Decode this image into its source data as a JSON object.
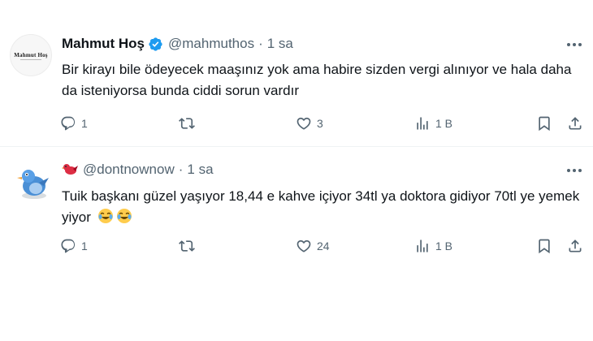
{
  "tweets": [
    {
      "avatar_text": "Mahmut Hoş",
      "name": "Mahmut Hoş",
      "verified": true,
      "handle": "@mahmuthos",
      "separator": "·",
      "time": "1 sa",
      "text": "Bir kirayı bile ödeyecek maaşınız yok ama habire sizden vergi alınıyor ve hala daha da isteniyorsa bunda ciddi sorun vardır",
      "emojis": [],
      "replies": "1",
      "retweets": "",
      "likes": "3",
      "views": "1 B"
    },
    {
      "avatar_icon": "bird-avatar",
      "name_emoji": "red-bird-emoji",
      "handle": "@dontnownow",
      "separator": "·",
      "time": "1 sa",
      "text": "Tuik başkanı güzel yaşıyor 18,44 e kahve içiyor 34tl ya doktora gidiyor 70tl ye yemek yiyor",
      "emojis": [
        "tears-of-joy-emoji",
        "tears-of-joy-emoji"
      ],
      "replies": "1",
      "retweets": "",
      "likes": "24",
      "views": "1 B"
    }
  ],
  "colors": {
    "text_primary": "#0f1419",
    "text_secondary": "#536471",
    "verified_blue": "#1d9bf0",
    "divider": "#eff3f4"
  }
}
